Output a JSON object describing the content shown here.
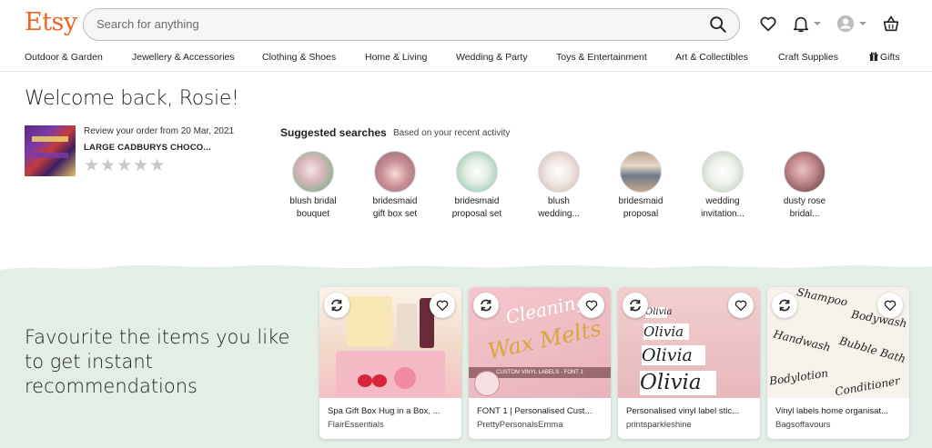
{
  "header": {
    "logo": "Etsy",
    "search_placeholder": "Search for anything"
  },
  "icons": {
    "search": "search-icon",
    "favorites": "heart-icon",
    "notifications": "bell-icon",
    "account": "avatar-icon",
    "cart": "basket-icon",
    "gift": "gift-icon",
    "refresh": "refresh-icon",
    "star": "star-icon"
  },
  "nav": {
    "items": [
      "Outdoor & Garden",
      "Jewellery & Accessories",
      "Clothing & Shoes",
      "Home & Living",
      "Wedding & Party",
      "Toys & Entertainment",
      "Art & Collectibles",
      "Craft Supplies",
      "Gifts"
    ]
  },
  "welcome": "Welcome back, Rosie!",
  "review": {
    "prompt": "Review your order from 20 Mar, 2021",
    "item": "LARGE CADBURYS CHOCO...",
    "stars_rating": 0,
    "stars_total": 5
  },
  "suggested": {
    "title": "Suggested searches",
    "subtitle": "Based on your recent activity",
    "items": [
      {
        "line1": "blush bridal",
        "line2": "bouquet"
      },
      {
        "line1": "bridesmaid",
        "line2": "gift box set"
      },
      {
        "line1": "bridesmaid",
        "line2": "proposal set"
      },
      {
        "line1": "blush",
        "line2": "wedding..."
      },
      {
        "line1": "bridesmaid",
        "line2": "proposal"
      },
      {
        "line1": "wedding",
        "line2": "invitation..."
      },
      {
        "line1": "dusty rose",
        "line2": "bridal..."
      }
    ]
  },
  "favourites": {
    "headline": "Favourite the items you like to get instant recommendations"
  },
  "cards": [
    {
      "title": "Spa Gift Box Hug in a Box, ...",
      "shop": "FlairEssentials"
    },
    {
      "title": "FONT 1 | Personalised Cust...",
      "shop": "PrettyPersonalsEmma",
      "img_text": "CUSTOM VINYL LABELS - FONT 1"
    },
    {
      "title": "Personalised vinyl label stic...",
      "shop": "printsparkleshine",
      "img_words": [
        "Olivia",
        "Olivia",
        "Olivia",
        "Olivia"
      ]
    },
    {
      "title": "Vinyl labels home organisat...",
      "shop": "Bagsoffavours",
      "img_words": [
        "Shampoo",
        "Bodywash",
        "Handwash",
        "Bubble Bath",
        "Bodylotion",
        "Conditioner"
      ]
    }
  ],
  "colors": {
    "brand": "#f1641e",
    "band": "#e3eee6"
  }
}
